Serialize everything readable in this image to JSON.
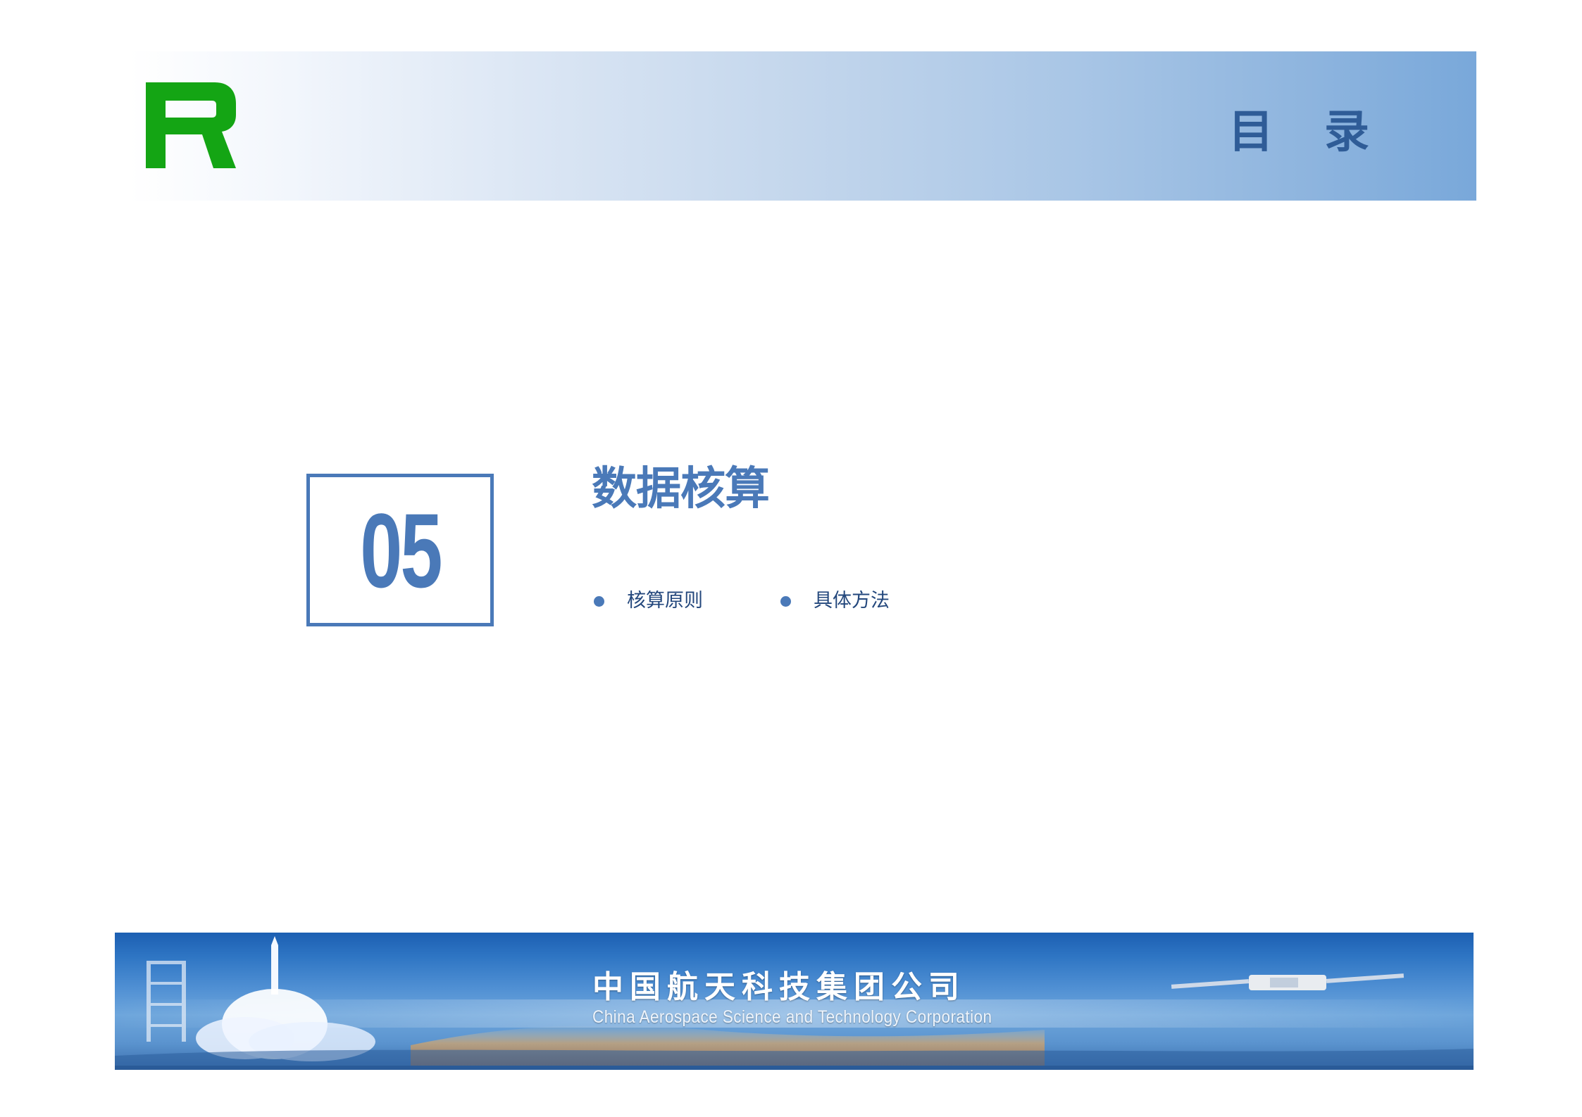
{
  "header": {
    "title": "目录",
    "brand_color": "#14a514",
    "accent_color": "#2f5c97"
  },
  "section": {
    "number": "05",
    "title": "数据核算",
    "subtopics": [
      {
        "label": "核算原则"
      },
      {
        "label": "具体方法"
      }
    ],
    "accent_color": "#4a79b8"
  },
  "footer": {
    "corp_name_cn": "中国航天科技集团公司",
    "corp_name_en": "China Aerospace Science and Technology Corporation"
  }
}
